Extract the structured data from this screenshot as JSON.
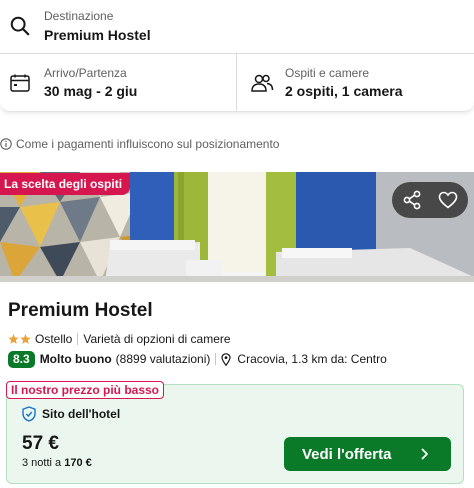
{
  "search": {
    "destination_label": "Destinazione",
    "destination_value": "Premium Hostel",
    "dates_label": "Arrivo/Partenza",
    "dates_value": "30 mag - 2 giu",
    "guests_label": "Ospiti e camere",
    "guests_value": "2 ospiti, 1 camera"
  },
  "info": {
    "text": "Come i pagamenti influiscono sul posizionamento"
  },
  "hotel": {
    "badge": "La scelta degli ospiti",
    "name": "Premium Hostel",
    "star_count": 2,
    "type": "Ostello",
    "amenity": "Varietà di opzioni di camere",
    "rating_score": "8.3",
    "rating_text": "Molto buono",
    "rating_count": "(8899 valutazioni)",
    "location": "Cracovia, 1.3 km da: Centro"
  },
  "deal": {
    "tag": "Il nostro prezzo più basso",
    "provider": "Sito dell'hotel",
    "price": "57 €",
    "nights_prefix": "3 notti a",
    "total": "170 €",
    "cta": "Vedi l'offerta"
  },
  "icons": {
    "search": "search-icon",
    "calendar": "calendar-icon",
    "guests": "people-icon",
    "info": "info-icon",
    "share": "share-icon",
    "favorite": "heart-icon",
    "location": "location-pin-icon",
    "provider": "shield-check-icon",
    "cta": "chevron-right-icon"
  },
  "colors": {
    "brand_green": "#0a7a29",
    "badge_pink": "#d6174f",
    "star": "#e8a33d",
    "deal_bg": "#ebf7ee"
  }
}
